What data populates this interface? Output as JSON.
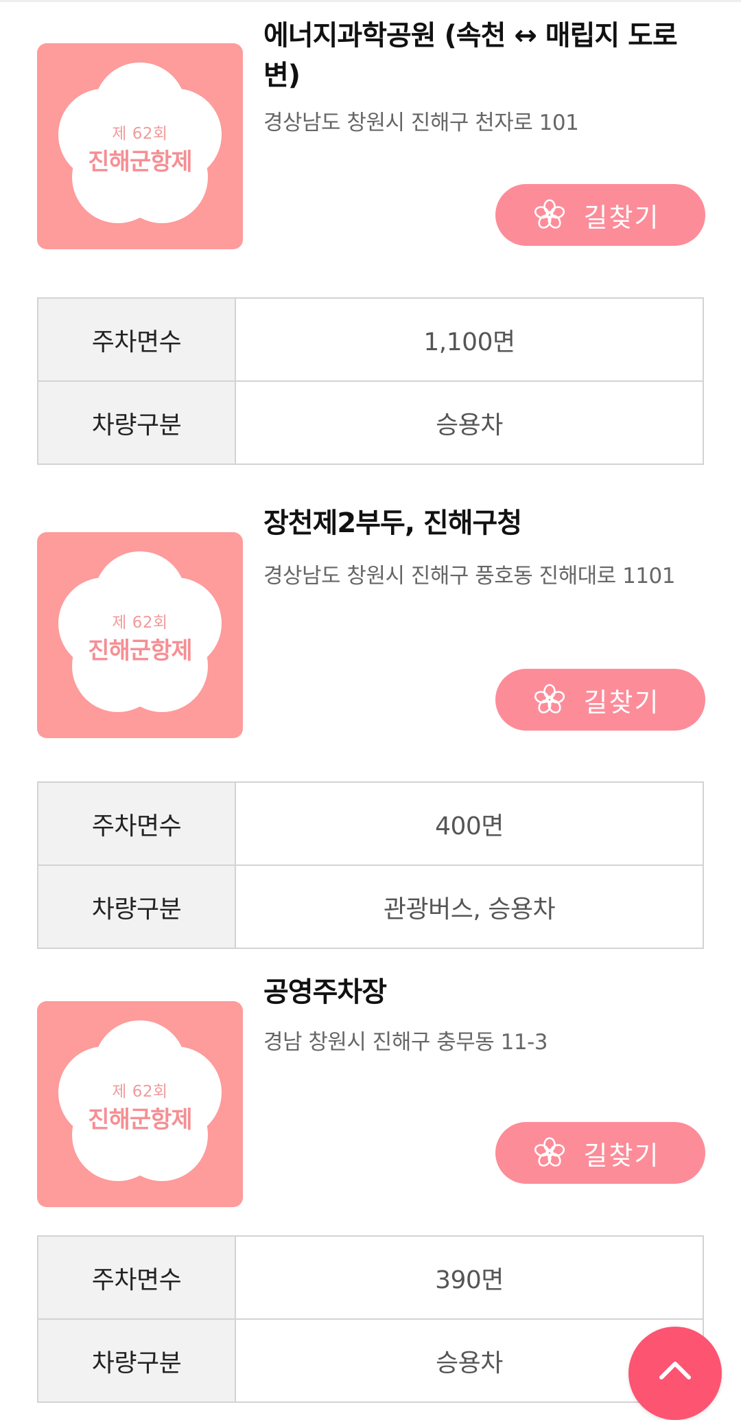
{
  "badge": {
    "sub": "제 62회",
    "main": "진해군항제"
  },
  "lots": [
    {
      "title": "에너지과학공원 (속천 ↔ 매립지 도로변)",
      "address": "경상남도 창원시 진해구 천자로 101",
      "route_label": "길찾기",
      "rows": [
        {
          "key": "주차면수",
          "value": "1,100면"
        },
        {
          "key": "차량구분",
          "value": "승용차"
        }
      ]
    },
    {
      "title": "장천제2부두, 진해구청",
      "address": "경상남도 창원시 진해구 풍호동 진해대로 1101",
      "route_label": "길찾기",
      "rows": [
        {
          "key": "주차면수",
          "value": "400면"
        },
        {
          "key": "차량구분",
          "value": "관광버스, 승용차"
        }
      ]
    },
    {
      "title": "공영주차장",
      "address": "경남 창원시 진해구 충무동 11-3",
      "route_label": "길찾기",
      "rows": [
        {
          "key": "주차면수",
          "value": "390면"
        },
        {
          "key": "차량구분",
          "value": "승용차"
        }
      ]
    }
  ],
  "icons": {
    "thumbnail": "cherry-blossom-badge",
    "route": "cherry-blossom-icon",
    "scroll_top": "chevron-up-icon"
  },
  "colors": {
    "thumbnail_bg": "#fe9b9b",
    "route_button": "#fd8c99",
    "scroll_top_button": "#fc5471",
    "badge_text": "#f58f94"
  }
}
